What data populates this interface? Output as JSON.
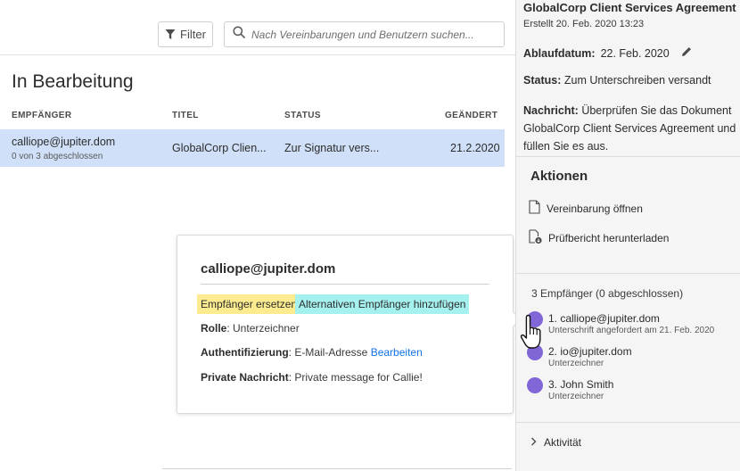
{
  "toolbar": {
    "filter_label": "Filter",
    "search_placeholder": "Nach Vereinbarungen und Benutzern suchen..."
  },
  "list": {
    "section_title": "In Bearbeitung",
    "columns": [
      "EMPFÄNGER",
      "TITEL",
      "STATUS",
      "GEÄNDERT"
    ],
    "rows": [
      {
        "recipient": "calliope@jupiter.dom",
        "progress": "0 von 3 abgeschlossen",
        "title": "GlobalCorp Clien...",
        "status": "Zur Signatur vers...",
        "changed": "21.2.2020"
      }
    ]
  },
  "popover": {
    "email": "calliope@jupiter.dom",
    "replace_label": "Empfänger ersetzen",
    "add_alt_label": "Alternativen Empfänger hinzufügen",
    "role_label": "Rolle",
    "role_value": "Unterzeichner",
    "auth_label": "Authentifizierung",
    "auth_value": "E-Mail-Adresse",
    "auth_edit": "Bearbeiten",
    "private_label": "Private Nachricht",
    "private_value": "Private message for Callie!"
  },
  "panel": {
    "agreement_title": "GlobalCorp Client Services Agreement",
    "created": "Erstellt 20. Feb. 2020 13:23",
    "expiry_label": "Ablaufdatum:",
    "expiry_value": "22. Feb. 2020",
    "status_label": "Status:",
    "status_value": "Zum Unterschreiben versandt",
    "message_label": "Nachricht:",
    "message_value": "Überprüfen Sie das Dokument GlobalCorp Client Services Agreement und füllen Sie es aus.",
    "actions_heading": "Aktionen",
    "actions": [
      {
        "label": "Vereinbarung öffnen",
        "icon": "document-icon"
      },
      {
        "label": "Prüfbericht herunterladen",
        "icon": "audit-report-icon"
      }
    ],
    "recipients_heading": "3 Empfänger (0 abgeschlossen)",
    "recipients": [
      {
        "name": "1. calliope@jupiter.dom",
        "detail": "Unterschrift angefordert am 21. Feb. 2020"
      },
      {
        "name": "2. io@jupiter.dom",
        "detail": "Unterzeichner"
      },
      {
        "name": "3. John Smith",
        "detail": "Unterzeichner"
      }
    ],
    "activity_label": "Aktivität"
  },
  "colors": {
    "selected_row": "#cfe0f8",
    "highlight_yellow": "#fcec8f",
    "highlight_cyan": "#a5f1ef",
    "link": "#1473e6",
    "recipient_dot": "#8066d6",
    "panel_bg": "#f5f5f5"
  }
}
